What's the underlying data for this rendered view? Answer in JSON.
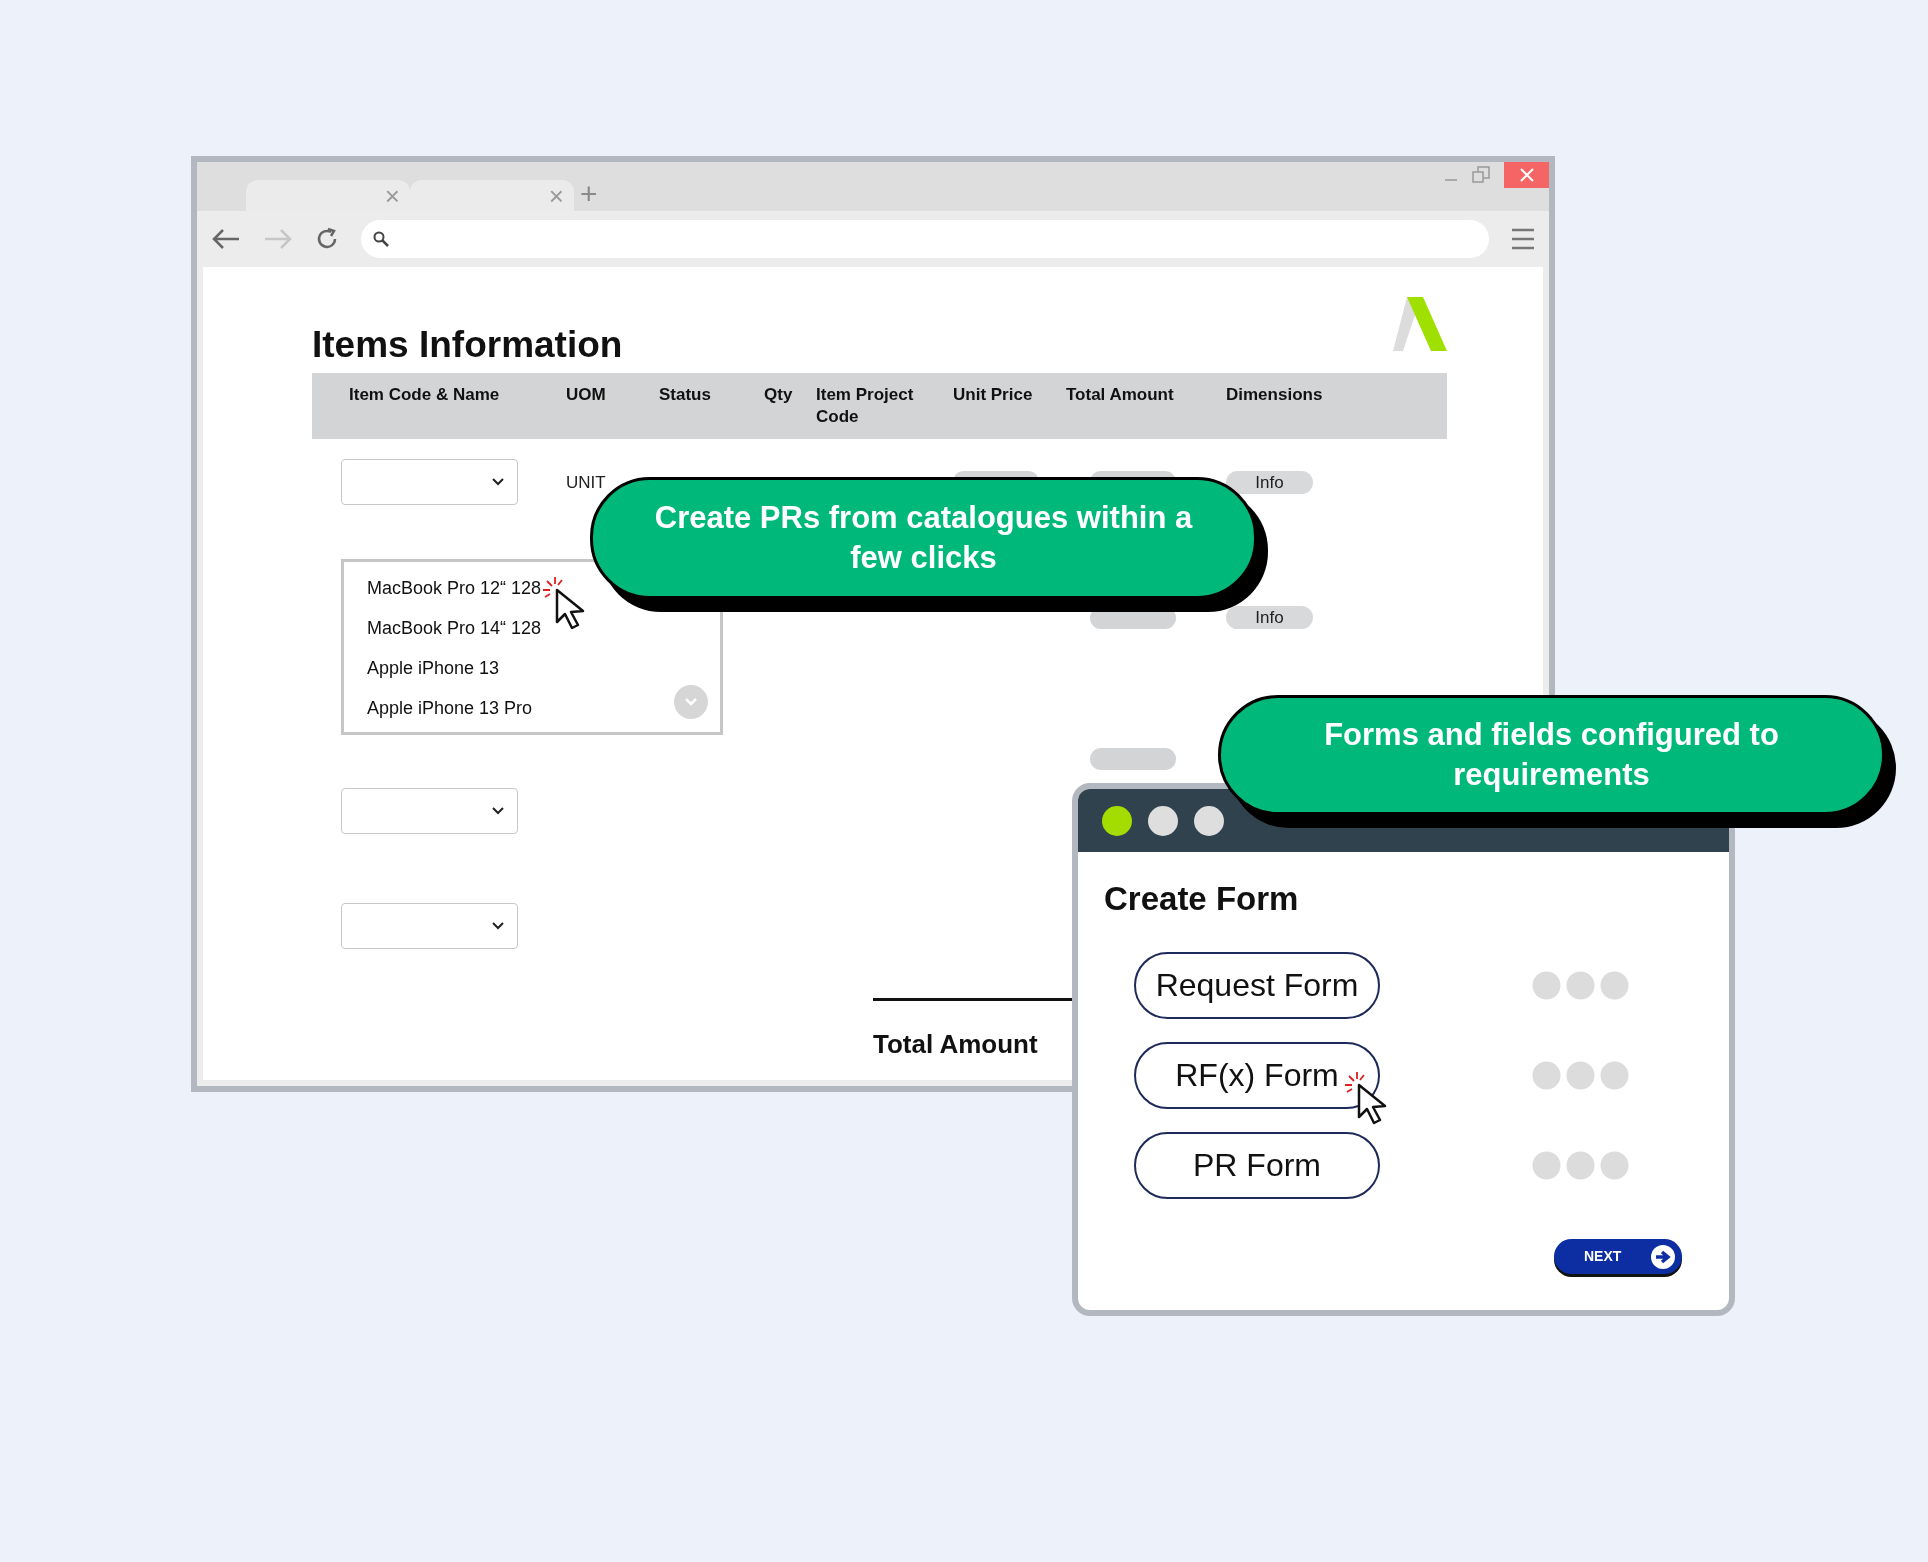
{
  "browser": {
    "tabs": [
      {
        "close": "×"
      },
      {
        "close": "×"
      }
    ],
    "new_tab": "+"
  },
  "page": {
    "title": "Items Information",
    "table": {
      "columns": [
        "Item Code & Name",
        "UOM",
        "Status",
        "Qty",
        "Item Project Code",
        "Unit Price",
        "Total Amount",
        "Dimensions"
      ],
      "rows": [
        {
          "kind": "select",
          "uom": "UNIT",
          "dimensions": "Info"
        },
        {
          "kind": "listbox",
          "options": [
            "MacBook Pro 12“ 128",
            "MacBook Pro 14“ 128",
            "Apple iPhone 13",
            "Apple iPhone 13 Pro"
          ],
          "dimensions": "Info"
        },
        {
          "kind": "select"
        },
        {
          "kind": "select"
        }
      ]
    },
    "total_label": "Total Amount"
  },
  "callouts": [
    {
      "text": "Create PRs from catalogues within a few clicks"
    },
    {
      "text": "Forms and fields configured to requirements"
    }
  ],
  "form_window": {
    "dots": [
      {
        "color": "#a3dd00"
      },
      {
        "color": "#dedede"
      },
      {
        "color": "#dedede"
      }
    ],
    "title": "Create Form",
    "options": [
      {
        "label": "Request Form"
      },
      {
        "label": "RF(x) Form"
      },
      {
        "label": "PR Form"
      }
    ],
    "next_button": "NEXT"
  }
}
